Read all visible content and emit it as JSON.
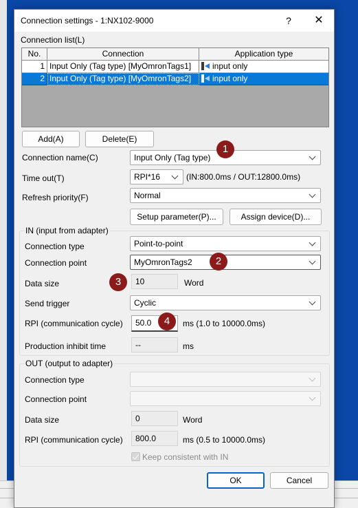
{
  "window": {
    "title": "Connection settings  - 1:NX102-9000",
    "help_icon": "?",
    "close_icon": "✕"
  },
  "connection_list": {
    "label": "Connection list(L)",
    "headers": {
      "no": "No.",
      "connection": "Connection",
      "app_type": "Application type"
    },
    "rows": [
      {
        "no": "1",
        "connection": "Input Only (Tag type) [MyOmronTags1]",
        "app_type": "input only"
      },
      {
        "no": "2",
        "connection": "Input Only (Tag type) [MyOmronTags2]",
        "app_type": "input only"
      }
    ]
  },
  "buttons": {
    "add": "Add(A)",
    "delete": "Delete(E)",
    "setup": "Setup parameter(P)...",
    "assign": "Assign device(D)...",
    "ok": "OK",
    "cancel": "Cancel"
  },
  "general": {
    "connection_name_label": "Connection name(C)",
    "connection_name_value": "Input Only (Tag type)",
    "timeout_label": "Time out(T)",
    "timeout_value": "RPI*16",
    "timeout_info": "(IN:800.0ms / OUT:12800.0ms)",
    "refresh_label": "Refresh priority(F)",
    "refresh_value": "Normal"
  },
  "in_group": {
    "title": "IN (input from adapter)",
    "connection_type_label": "Connection type",
    "connection_type_value": "Point-to-point",
    "connection_point_label": "Connection point",
    "connection_point_value": "MyOmronTags2",
    "data_size_label": "Data size",
    "data_size_value": "10",
    "data_size_unit": "Word",
    "send_trigger_label": "Send trigger",
    "send_trigger_value": "Cyclic",
    "rpi_label": "RPI (communication cycle)",
    "rpi_value": "50.0",
    "rpi_unit": "ms  (1.0 to 10000.0ms)",
    "inhibit_label": "Production inhibit time",
    "inhibit_value": "--",
    "inhibit_unit": "ms"
  },
  "out_group": {
    "title": "OUT (output to adapter)",
    "connection_type_label": "Connection type",
    "connection_point_label": "Connection point",
    "data_size_label": "Data size",
    "data_size_value": "0",
    "data_size_unit": "Word",
    "rpi_label": "RPI (communication cycle)",
    "rpi_value": "800.0",
    "rpi_unit": "ms  (0.5 to 10000.0ms)",
    "keep_label": "Keep consistent with IN",
    "keep_checked": true
  },
  "annotations": [
    "1",
    "2",
    "3",
    "4"
  ],
  "colors": {
    "selection": "#0a78d7",
    "badge": "#8b1a1a",
    "desktop": "#0b47a6",
    "primary_border": "#0a62c8"
  }
}
